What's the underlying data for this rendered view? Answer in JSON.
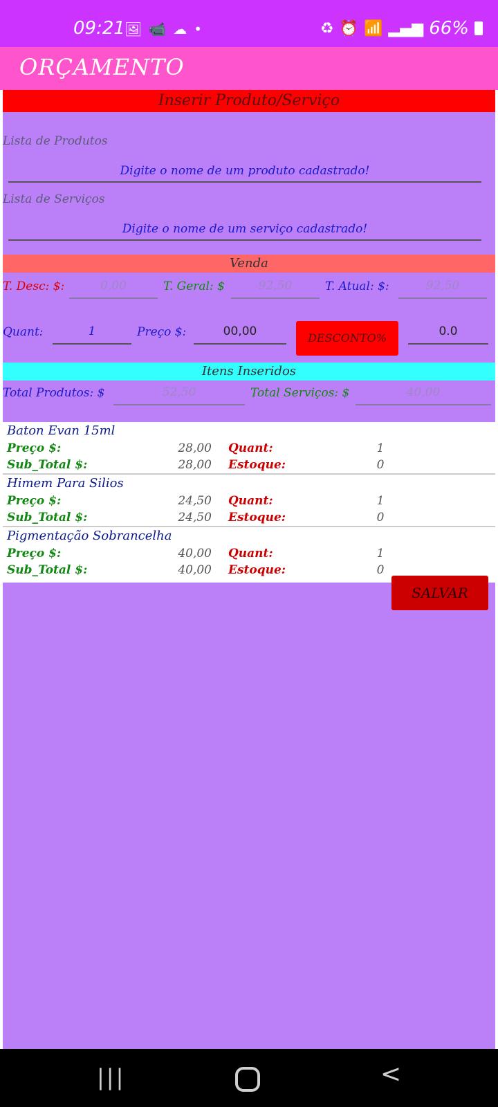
{
  "status_bar": {
    "time": "09:21",
    "battery": "66%",
    "left_icons": [
      "image-icon",
      "cctv-icon",
      "cloud-icon",
      "dot-icon"
    ],
    "right_icons": [
      "battery-saver-icon",
      "alarm-icon",
      "wifi-icon",
      "signal-icon",
      "signal-icon",
      "battery-icon"
    ]
  },
  "app_bar": {
    "title": "ORÇAMENTO"
  },
  "sections": {
    "insert": "Inserir Produto/Serviço",
    "venda": "Venda",
    "itens": "Itens Inseridos"
  },
  "produtos": {
    "label": "Lista de Produtos",
    "placeholder": "Digite o nome de um produto cadastrado!"
  },
  "servicos": {
    "label": "Lista de Serviços",
    "placeholder": "Digite o nome de um serviço cadastrado!"
  },
  "totais": {
    "desc_label": "T. Desc: $:",
    "desc_value": "0,00",
    "geral_label": "T. Geral: $",
    "geral_value": "92,50",
    "atual_label": "T. Atual: $:",
    "atual_value": "92,50"
  },
  "venda": {
    "quant_label": "Quant:",
    "quant_value": "1",
    "preco_label": "Preço $:",
    "preco_value": "00,00",
    "desconto_button": "DESCONTO%",
    "desconto_value": "0.0"
  },
  "resumo": {
    "produtos_label": "Total Produtos: $",
    "produtos_value": "52,50",
    "servicos_label": "Total Serviços: $",
    "servicos_value": "40,00"
  },
  "labels": {
    "preco": "Preço $:",
    "subtotal": "Sub_Total $:",
    "quant": "Quant:",
    "estoque": "Estoque:"
  },
  "items": [
    {
      "name": "Baton Evan 15ml",
      "preco": "28,00",
      "subtotal": "28,00",
      "quant": "1",
      "estoque": "0"
    },
    {
      "name": "Himem Para Silios",
      "preco": "24,50",
      "subtotal": "24,50",
      "quant": "1",
      "estoque": "0"
    },
    {
      "name": "Pigmentação Sobrancelha",
      "preco": "40,00",
      "subtotal": "40,00",
      "quant": "1",
      "estoque": "0"
    }
  ],
  "save_button": "SALVAR",
  "nav": {
    "recent": "|||",
    "back": "<"
  },
  "colors": {
    "status_bar": "#cc33ff",
    "app_bar": "#ff55cc",
    "background": "#bb80f7",
    "insert_band": "#ff0000",
    "venda_band": "#ff6666",
    "itens_band": "#33ffff",
    "save_button": "#cc0000"
  }
}
